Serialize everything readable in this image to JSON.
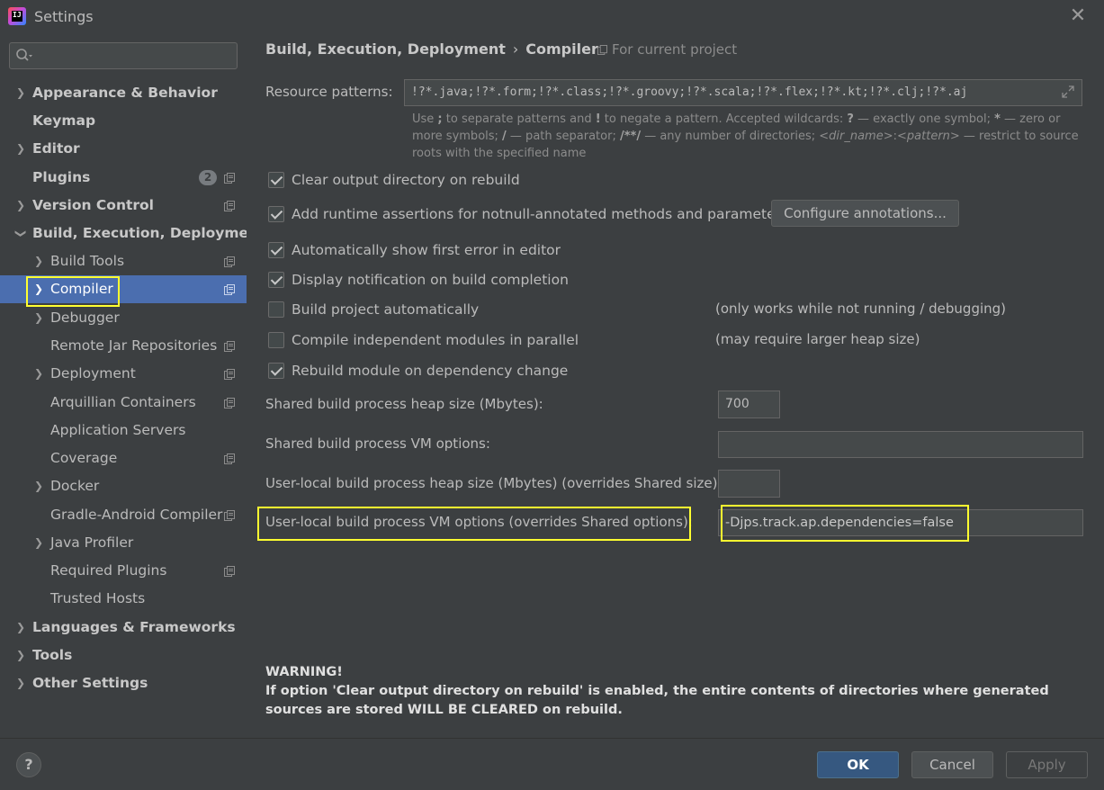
{
  "window": {
    "title": "Settings",
    "app_icon_text": "IJ"
  },
  "search": {
    "placeholder": "",
    "value": ""
  },
  "sidebar": {
    "items": [
      {
        "label": "Appearance & Behavior"
      },
      {
        "label": "Keymap"
      },
      {
        "label": "Editor"
      },
      {
        "label": "Plugins",
        "badge": "2"
      },
      {
        "label": "Version Control"
      },
      {
        "label": "Build, Execution, Deployment"
      },
      {
        "label": "Build Tools"
      },
      {
        "label": "Compiler"
      },
      {
        "label": "Debugger"
      },
      {
        "label": "Remote Jar Repositories"
      },
      {
        "label": "Deployment"
      },
      {
        "label": "Arquillian Containers"
      },
      {
        "label": "Application Servers"
      },
      {
        "label": "Coverage"
      },
      {
        "label": "Docker"
      },
      {
        "label": "Gradle-Android Compiler"
      },
      {
        "label": "Java Profiler"
      },
      {
        "label": "Required Plugins"
      },
      {
        "label": "Trusted Hosts"
      },
      {
        "label": "Languages & Frameworks"
      },
      {
        "label": "Tools"
      },
      {
        "label": "Other Settings"
      }
    ],
    "selected": "Compiler"
  },
  "breadcrumb": {
    "parent": "Build, Execution, Deployment",
    "separator": "›",
    "current": "Compiler"
  },
  "scope": {
    "label": "For current project"
  },
  "resource_patterns": {
    "label": "Resource patterns:",
    "value": "!?*.java;!?*.form;!?*.class;!?*.groovy;!?*.scala;!?*.flex;!?*.kt;!?*.clj;!?*.aj",
    "hint": {
      "p1": "Use ",
      "b1": ";",
      "p2": " to separate patterns and ",
      "b2": "!",
      "p3": " to negate a pattern. Accepted wildcards: ",
      "b3": "?",
      "p4": " — exactly one symbol; ",
      "b4": "*",
      "p5": " — zero or more symbols; ",
      "b5": "/",
      "p6": " — path separator; ",
      "b6": "/**/",
      "p7": " — any number of directories; ",
      "i1": "<dir_name>",
      "p8": ":",
      "i2": "<pattern>",
      "p9": " — restrict to source roots with the specified name"
    }
  },
  "options": {
    "clear_output": {
      "label": "Clear output directory on rebuild",
      "checked": true
    },
    "runtime_assertions": {
      "label": "Add runtime assertions for notnull-annotated methods and parameters",
      "checked": true
    },
    "configure_annotations": "Configure annotations...",
    "show_first_error": {
      "label": "Automatically show first error in editor",
      "checked": true
    },
    "notify_completion": {
      "label": "Display notification on build completion",
      "checked": true
    },
    "build_auto": {
      "label": "Build project automatically",
      "checked": false,
      "note": "(only works while not running / debugging)"
    },
    "compile_parallel": {
      "label": "Compile independent modules in parallel",
      "checked": false,
      "note": "(may require larger heap size)"
    },
    "rebuild_on_dep": {
      "label": "Rebuild module on dependency change",
      "checked": true
    }
  },
  "fields": {
    "shared_heap": {
      "label": "Shared build process heap size (Mbytes):",
      "value": "700"
    },
    "shared_vm": {
      "label": "Shared build process VM options:",
      "value": ""
    },
    "user_heap": {
      "label": "User-local build process heap size (Mbytes) (overrides Shared size):",
      "value": ""
    },
    "user_vm": {
      "label": "User-local build process VM options (overrides Shared options):",
      "value": "-Djps.track.ap.dependencies=false"
    }
  },
  "warning": {
    "title": "WARNING!",
    "text": "If option 'Clear output directory on rebuild' is enabled, the entire contents of directories where generated sources are stored WILL BE CLEARED on rebuild."
  },
  "footer": {
    "help": "?",
    "ok": "OK",
    "cancel": "Cancel",
    "apply": "Apply"
  },
  "colors": {
    "background": "#3c3f41",
    "selection": "#4b6eaf",
    "highlight": "#ffff30",
    "primary_button": "#365880"
  },
  "icons": {
    "close": "close-icon",
    "search": "search-icon",
    "project_scope": "project-scope-icon",
    "expand": "expand-icon",
    "help": "help-icon"
  }
}
